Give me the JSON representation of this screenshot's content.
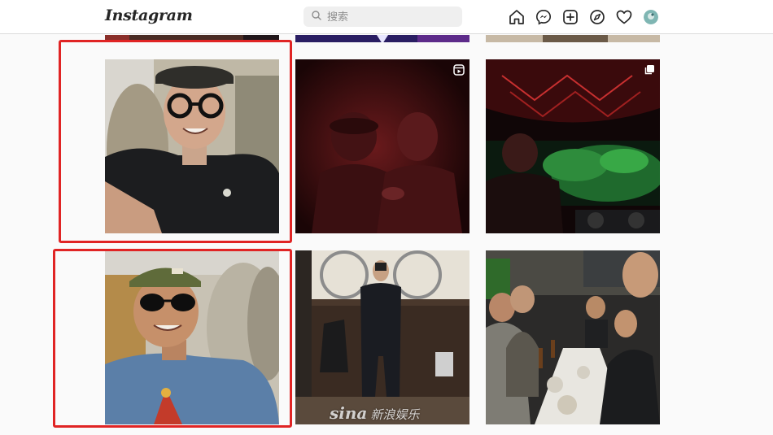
{
  "app": {
    "logo": "Instagram"
  },
  "search": {
    "placeholder": "搜索",
    "value": ""
  },
  "nav": {
    "icons": [
      "home-icon",
      "messenger-icon",
      "new-post-icon",
      "explore-icon",
      "activity-heart-icon",
      "profile-avatar"
    ]
  },
  "grid": {
    "previous_row": [
      {
        "kind": "photo"
      },
      {
        "kind": "photo"
      },
      {
        "kind": "photo"
      }
    ],
    "rows": [
      [
        {
          "kind": "photo",
          "description_icon": "none",
          "highlighted": true
        },
        {
          "kind": "reel",
          "description_icon": "reel-icon",
          "highlighted": false
        },
        {
          "kind": "carousel",
          "description_icon": "carousel-icon",
          "highlighted": false
        }
      ],
      [
        {
          "kind": "photo",
          "description_icon": "none",
          "highlighted": true
        },
        {
          "kind": "photo",
          "description_icon": "none",
          "highlighted": false,
          "watermark_logo": "sina",
          "watermark_text": "新浪娱乐"
        },
        {
          "kind": "photo",
          "description_icon": "none",
          "highlighted": false
        }
      ]
    ]
  },
  "colors": {
    "highlight": "#e02424",
    "background": "#fafafa",
    "topbar": "#ffffff"
  }
}
